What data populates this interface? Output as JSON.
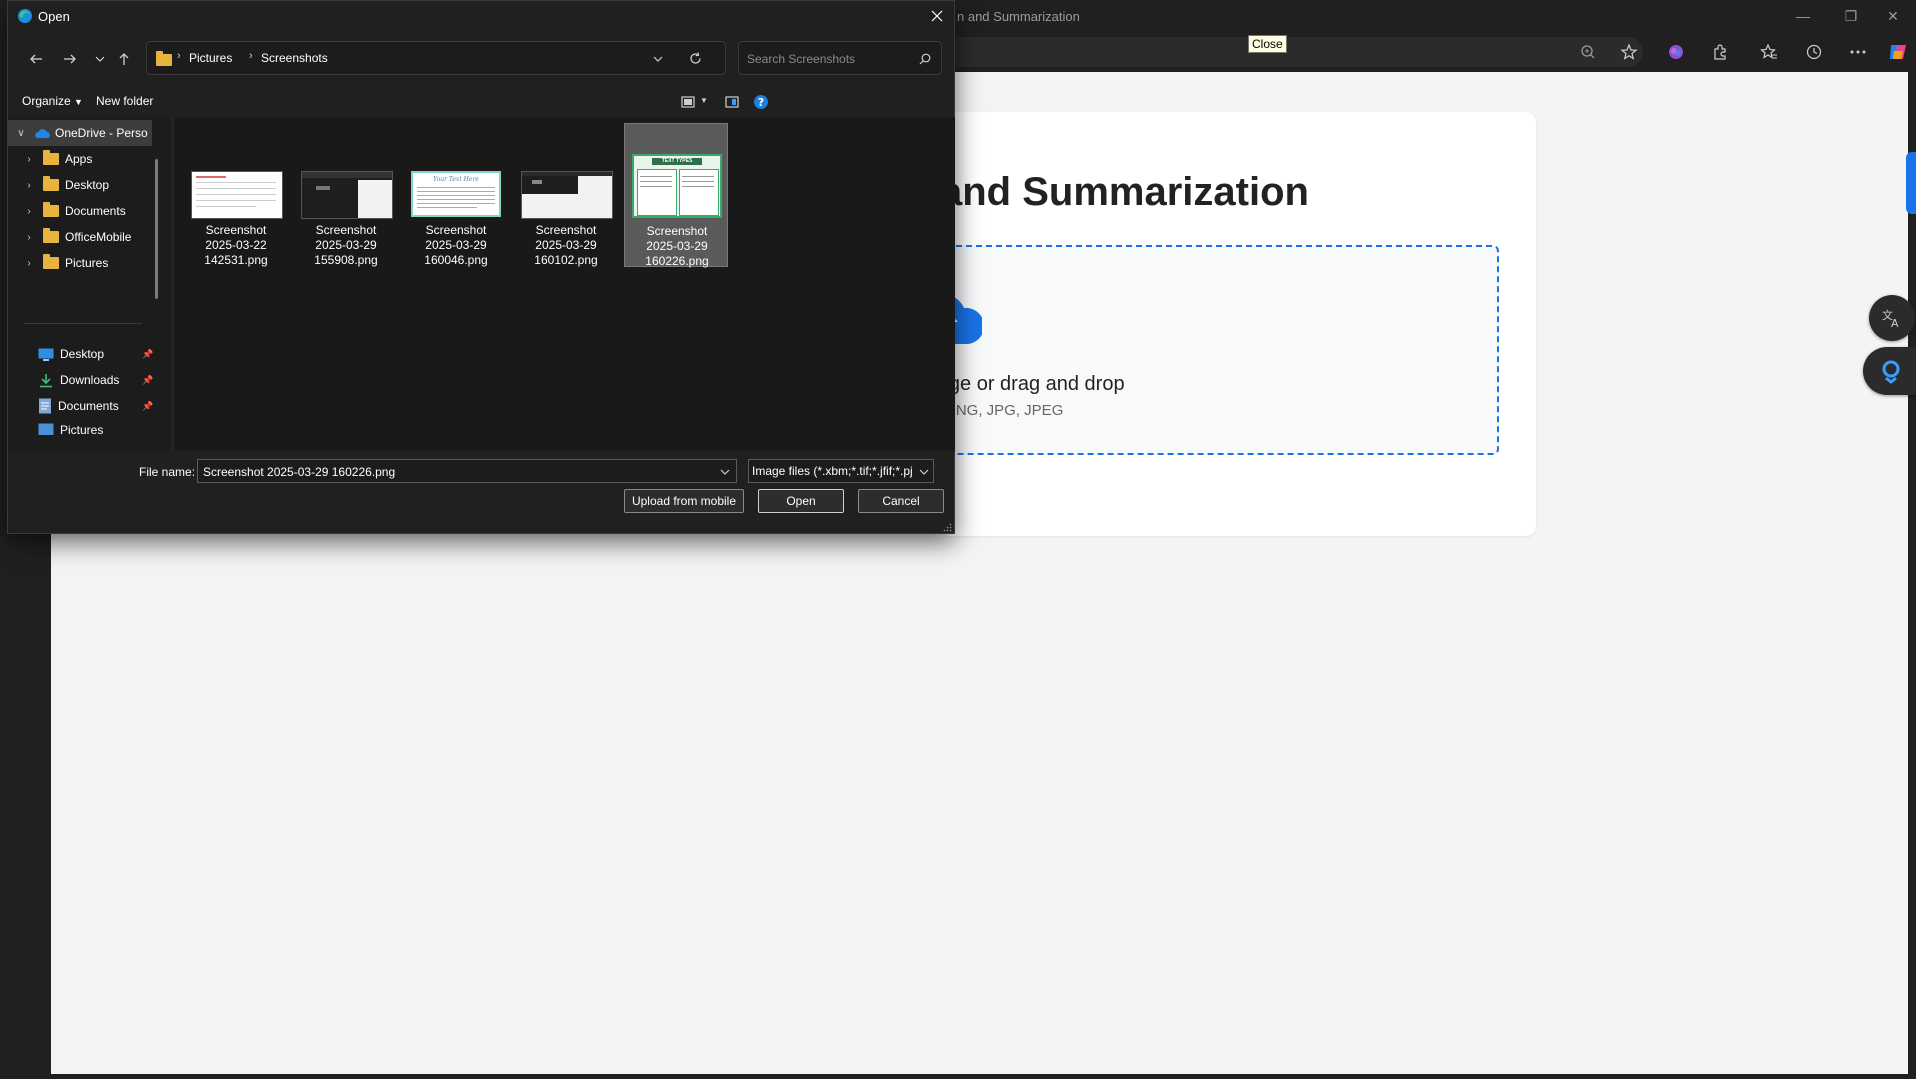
{
  "browser": {
    "title": "n and Summarization",
    "tooltip": "Close"
  },
  "page": {
    "heading": "and Summarization",
    "drop_text": "n image or drag and drop",
    "formats_text": "rmats: PNG, JPG, JPEG",
    "accent_color": "#1a73e8"
  },
  "dialog": {
    "title": "Open",
    "breadcrumb": [
      "Pictures",
      "Screenshots"
    ],
    "search_placeholder": "Search Screenshots",
    "commands": {
      "organize": "Organize",
      "new_folder": "New folder"
    },
    "nav_tree": [
      {
        "label": "OneDrive - Perso",
        "icon": "onedrive-icon"
      },
      {
        "label": "Apps",
        "icon": "folder-icon"
      },
      {
        "label": "Desktop",
        "icon": "folder-icon"
      },
      {
        "label": "Documents",
        "icon": "folder-icon"
      },
      {
        "label": "OfficeMobile",
        "icon": "folder-icon"
      },
      {
        "label": "Pictures",
        "icon": "folder-icon"
      }
    ],
    "quick_access": [
      {
        "label": "Desktop",
        "icon": "desktop-icon"
      },
      {
        "label": "Downloads",
        "icon": "download-icon"
      },
      {
        "label": "Documents",
        "icon": "document-icon"
      },
      {
        "label": "Pictures",
        "icon": "pictures-icon"
      }
    ],
    "files": [
      {
        "name": "Screenshot\n2025-03-22\n142531.png"
      },
      {
        "name": "Screenshot\n2025-03-29\n155908.png"
      },
      {
        "name": "Screenshot\n2025-03-29\n160046.png",
        "thumb_text": "Your Text Here"
      },
      {
        "name": "Screenshot\n2025-03-29\n160102.png"
      },
      {
        "name": "Screenshot\n2025-03-29\n160226.png",
        "selected": true,
        "thumb_text": "TEXT TYPES"
      }
    ],
    "file_name_label": "File name:",
    "file_name_value": "Screenshot 2025-03-29 160226.png",
    "file_type_filter": "Image files (*.xbm;*.tif;*.jfif;*.pj",
    "buttons": {
      "upload": "Upload from mobile",
      "open": "Open",
      "cancel": "Cancel"
    }
  }
}
